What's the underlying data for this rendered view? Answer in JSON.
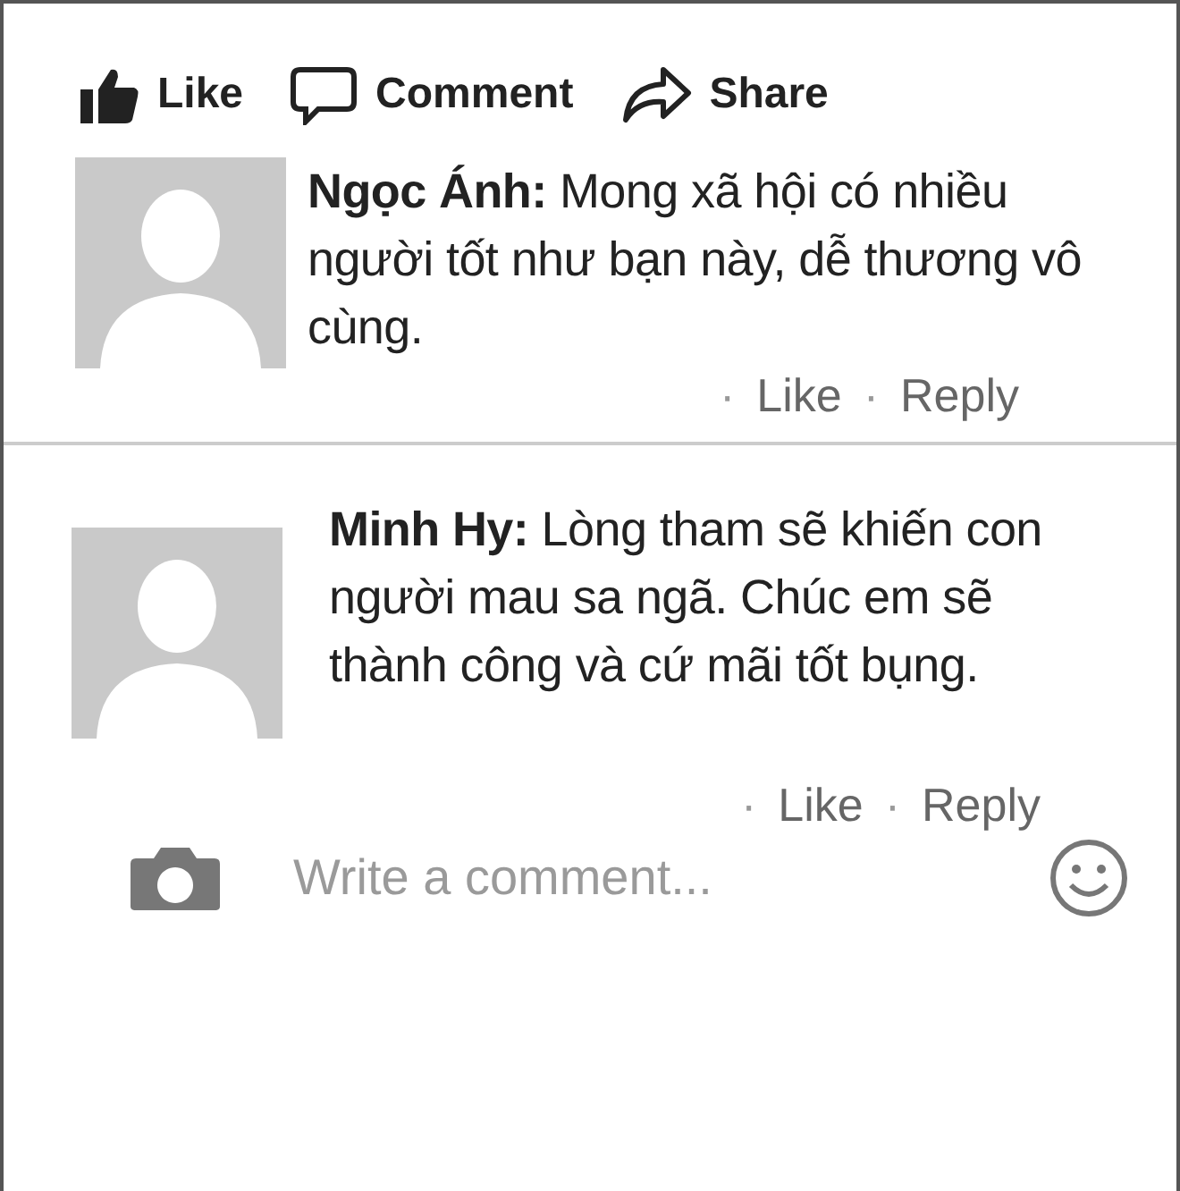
{
  "actions": [
    {
      "kind": "like",
      "label": "Like"
    },
    {
      "kind": "comment",
      "label": "Comment"
    },
    {
      "kind": "share",
      "label": "Share"
    }
  ],
  "comments": [
    {
      "author": "Ngọc Ánh:",
      "text": "Mong xã hội có nhiều người tốt như bạn này, dễ thương vô cùng.",
      "separator": "·",
      "links": [
        "Like",
        "Reply"
      ]
    },
    {
      "author": "Minh Hy:",
      "text": "Lòng tham sẽ khiến con người mau sa ngã. Chúc em sẽ thành công và cứ mãi tốt bụng.",
      "separator": "·",
      "links": [
        "Like",
        "Reply"
      ]
    }
  ],
  "composer": {
    "placeholder": "Write a comment..."
  }
}
